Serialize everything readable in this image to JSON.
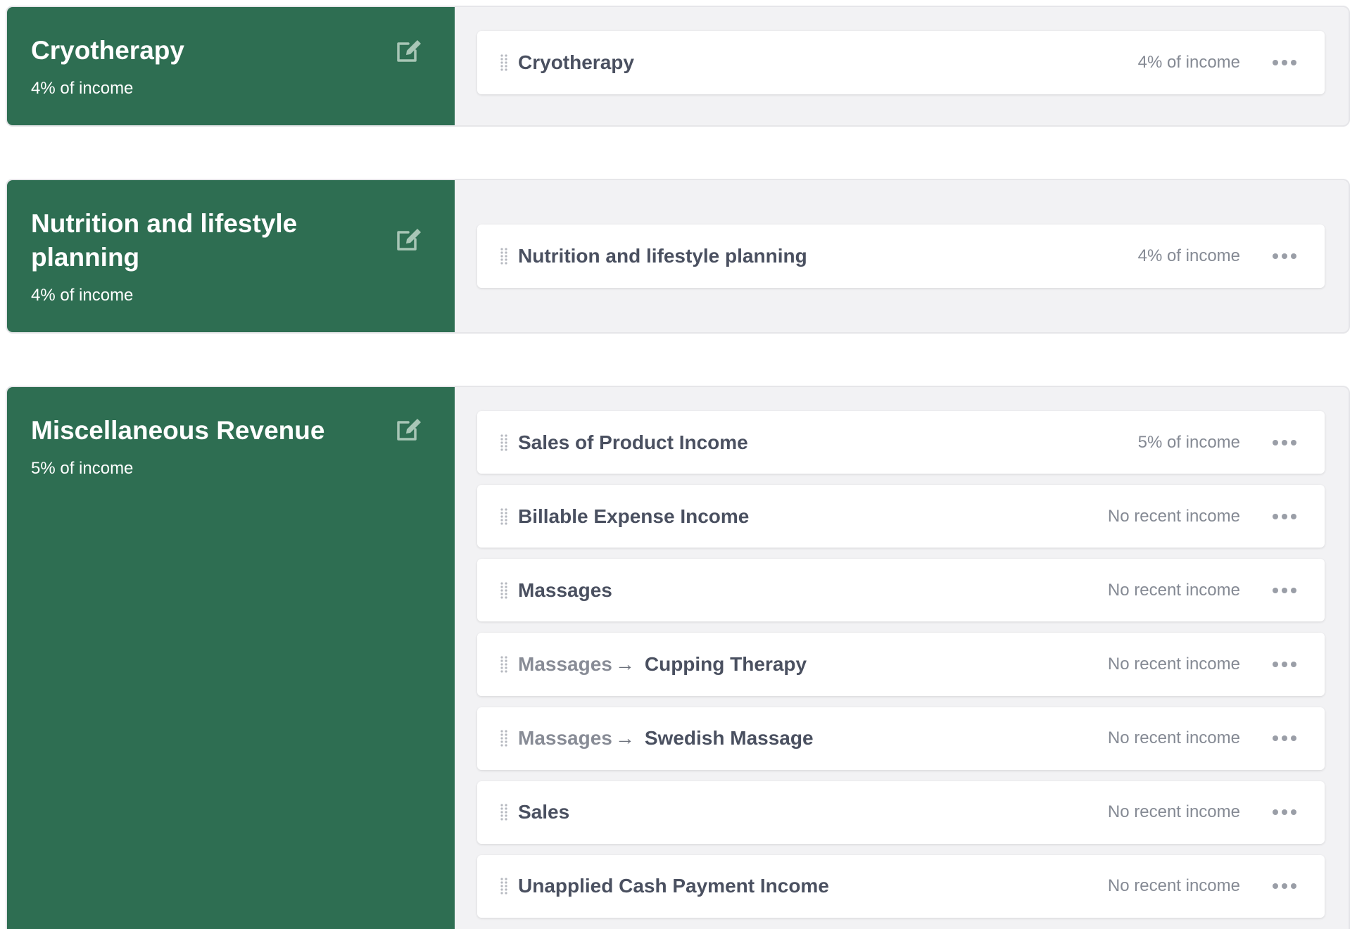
{
  "groups": [
    {
      "title": "Cryotherapy",
      "subtitle": "4% of income",
      "items": [
        {
          "name": "Cryotherapy",
          "meta": "4% of income"
        }
      ]
    },
    {
      "title": "Nutrition and lifestyle planning",
      "subtitle": "4% of income",
      "items": [
        {
          "name": "Nutrition and lifestyle planning",
          "meta": "4% of income"
        }
      ]
    },
    {
      "title": "Miscellaneous Revenue",
      "subtitle": "5% of income",
      "items": [
        {
          "name": "Sales of Product Income",
          "meta": "5% of income"
        },
        {
          "name": "Billable Expense Income",
          "meta": "No recent income"
        },
        {
          "name": "Massages",
          "meta": "No recent income"
        },
        {
          "parent": "Massages",
          "arrow": "→",
          "name": "Cupping Therapy",
          "meta": "No recent income"
        },
        {
          "parent": "Massages",
          "arrow": "→",
          "name": "Swedish Massage",
          "meta": "No recent income"
        },
        {
          "name": "Sales",
          "meta": "No recent income"
        },
        {
          "name": "Unapplied Cash Payment Income",
          "meta": "No recent income"
        }
      ]
    }
  ],
  "icons": {
    "edit": "edit-icon",
    "drag": "drag-handle-icon",
    "more": "more-horizontal-icon"
  },
  "colors": {
    "panel": "#2e6e52",
    "group_bg": "#f2f2f4",
    "text_dark": "#4a5060",
    "text_muted": "#858a94"
  }
}
